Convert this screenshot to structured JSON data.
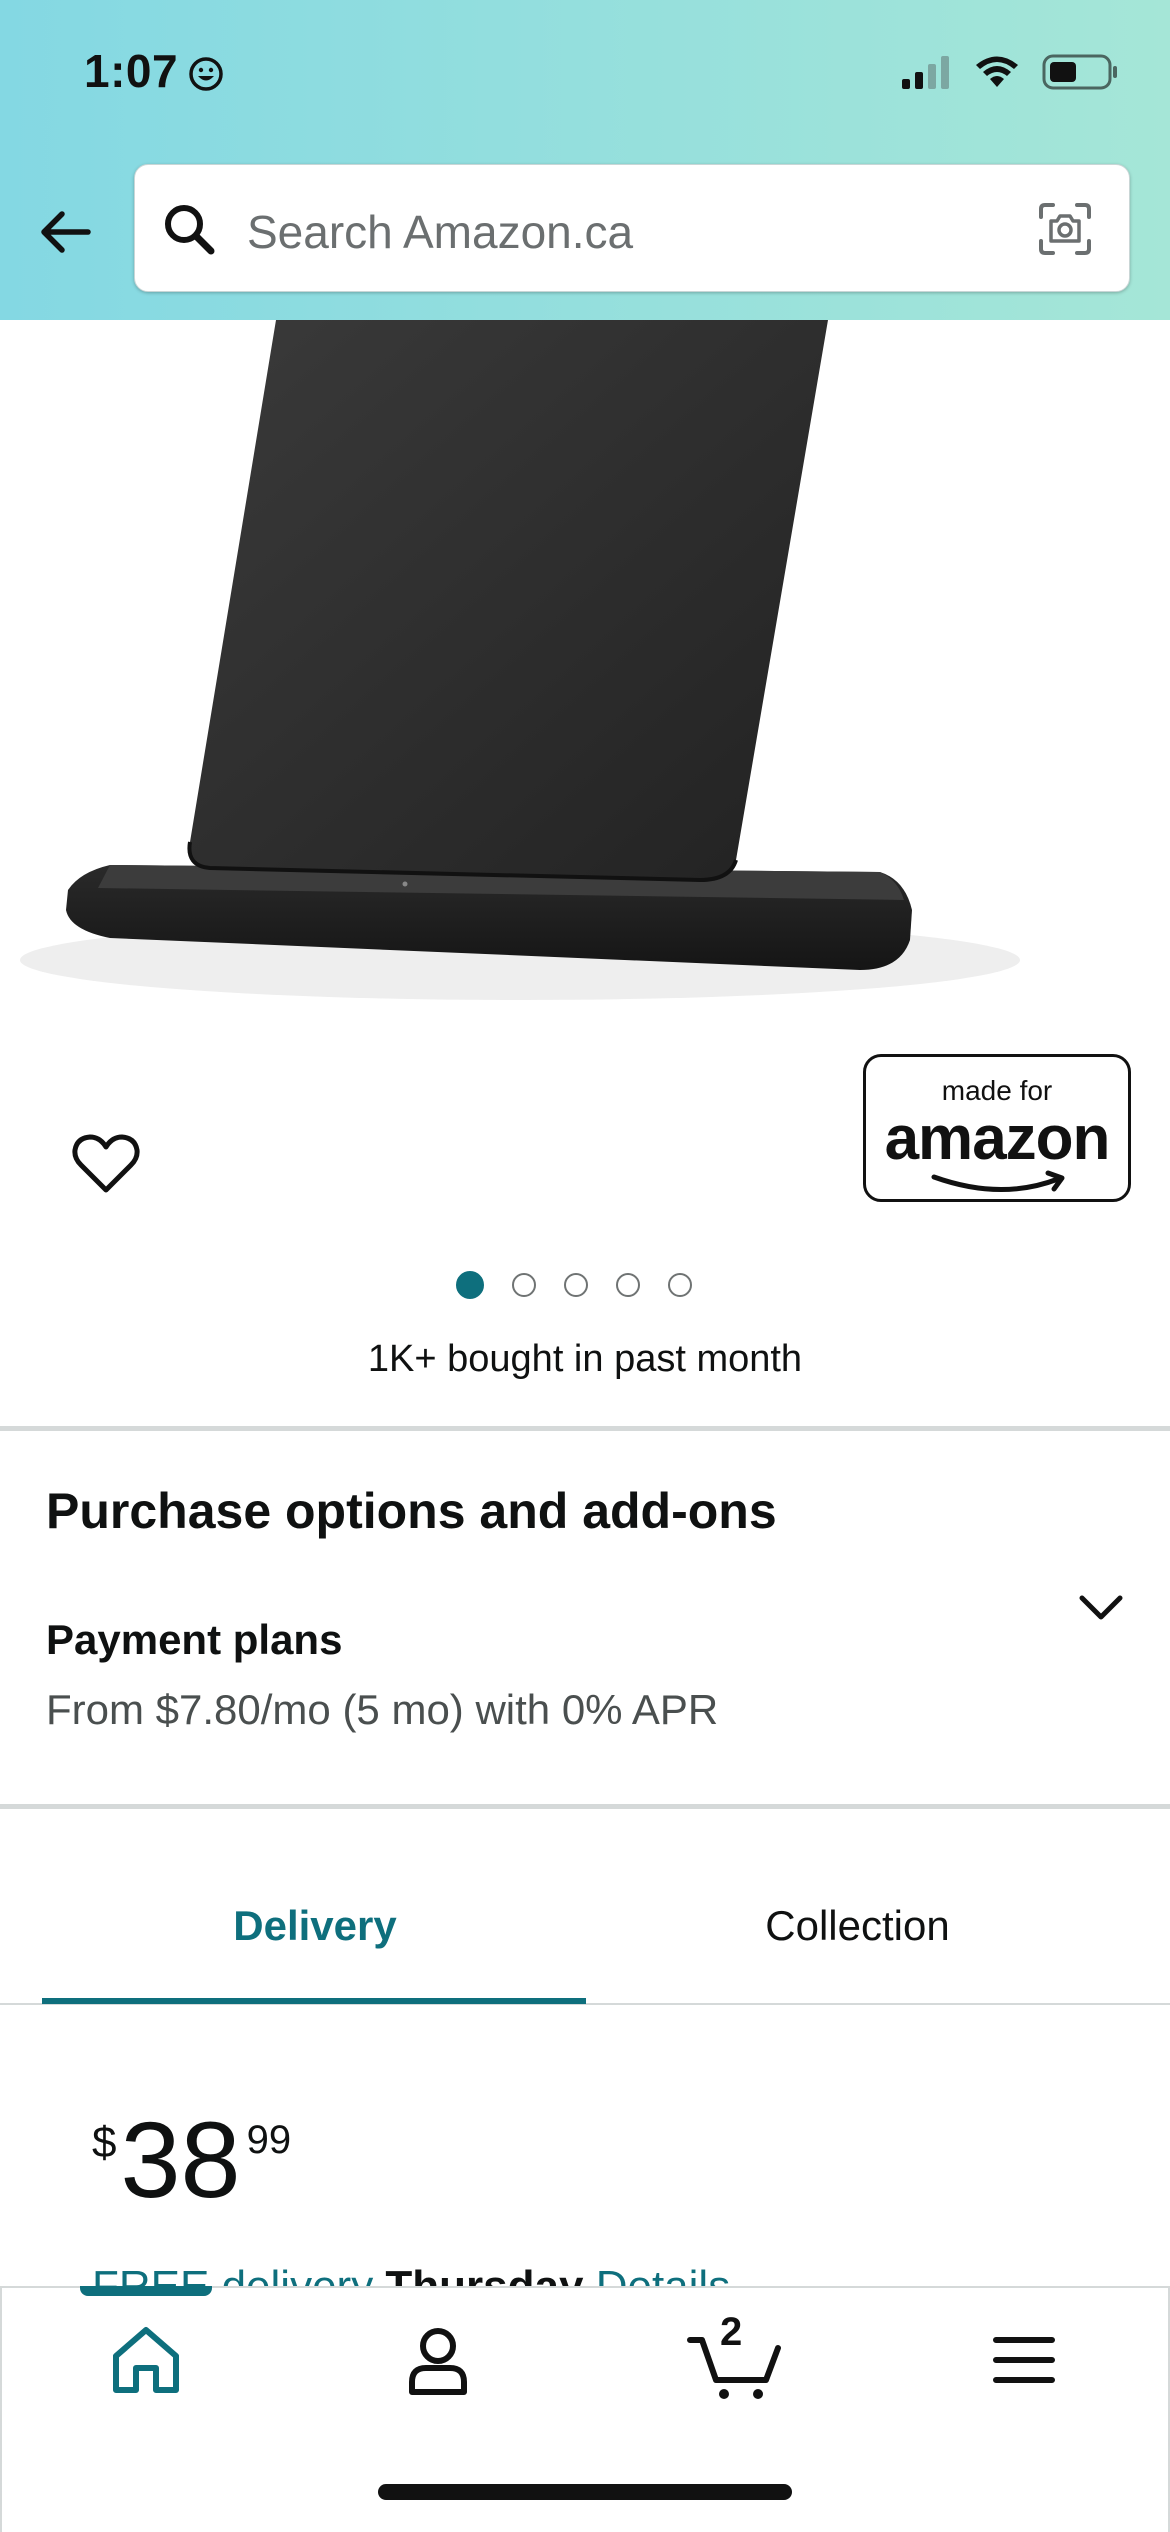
{
  "status_bar": {
    "time": "1:07"
  },
  "search": {
    "placeholder": "Search Amazon.ca"
  },
  "badge": {
    "line1": "made for",
    "line2": "amazon"
  },
  "carousel": {
    "total_images": 5,
    "active_index": 0
  },
  "product": {
    "bought_text": "1K+ bought in past month"
  },
  "purchase_options": {
    "title": "Purchase options and add-ons",
    "plans_title": "Payment plans",
    "plans_desc": "From $7.80/mo (5 mo) with 0% APR"
  },
  "tabs": [
    {
      "label": "Delivery",
      "selected": true
    },
    {
      "label": "Collection",
      "selected": false
    }
  ],
  "price": {
    "symbol": "$",
    "whole": "38",
    "fraction": "99"
  },
  "delivery": {
    "free_text": "FREE delivery",
    "day": "Thursday",
    "details": "Details"
  },
  "bottom_nav": {
    "cart_count": "2"
  },
  "colors": {
    "accent": "#0e6f7d",
    "header_start": "#84d8e3",
    "header_end": "#a5e6d7"
  }
}
